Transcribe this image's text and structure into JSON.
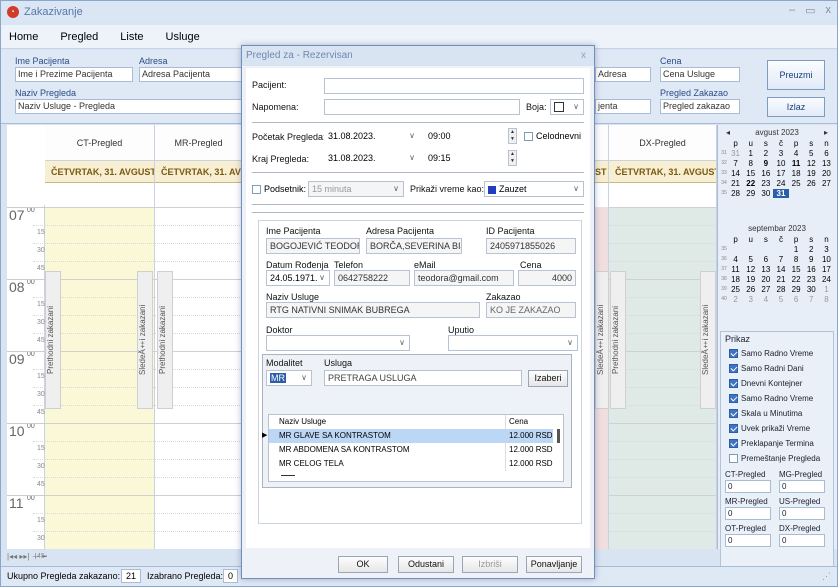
{
  "app": {
    "title": "Zakazivanje",
    "icon": "app-logo-icon"
  },
  "window_buttons": [
    "–",
    "▭",
    "x"
  ],
  "menu": [
    "Home",
    "Pregled",
    "Liste",
    "Usluge"
  ],
  "top": {
    "ime_label": "Ime Pacijenta",
    "ime_value": "Ime i Prezime Pacijenta",
    "adresa_label": "Adresa",
    "adresa_value": "Adresa Pacijenta",
    "naziv_label": "Naziv Pregleda",
    "naziv_value": "Naziv Usluge - Pregleda",
    "adresa2_value": "Adresa",
    "zak_value": "jenta",
    "cena_label": "Cena",
    "cena_value": "Cena Usluge",
    "pz_label": "Pregled Zakazao",
    "pz_value": "Pregled zakazao",
    "preuzmi": "Preuzmi",
    "izlaz": "Izlaz"
  },
  "calendar": {
    "columns": [
      {
        "name": "CT-Pregled",
        "date": "ČETVRTAK, 31. AVGUST"
      },
      {
        "name": "MR-Pregled",
        "date": "ČETVRTAK, 31. AVGUST"
      },
      {
        "name": "DX-Pregled",
        "date": "ČETVRTAK, 31. AVGUST"
      }
    ],
    "col3_date_fragment": "ST",
    "hours": [
      "07",
      "08",
      "09",
      "10",
      "11"
    ],
    "minutes": [
      "00",
      "15",
      "30",
      "45"
    ],
    "prev_label": "Prethodni zakazani",
    "next_label": "SledeÄ‡i zakazani",
    "nav": "|◂◂ ▸▸| ＋ ━"
  },
  "status": {
    "ukupno_label": "Ukupno Pregleda zakazano:",
    "ukupno_value": "21",
    "izabrano_label": "Izabrano Pregleda:",
    "izabrano_value": "0"
  },
  "minical": [
    {
      "title": "avgust 2023",
      "days": [
        "p",
        "u",
        "s",
        "č",
        "p",
        "s",
        "n"
      ],
      "weeks": [
        {
          "wk": "31",
          "d": [
            "31",
            "1",
            "2",
            "3",
            "4",
            "5",
            "6"
          ]
        },
        {
          "wk": "32",
          "d": [
            "7",
            "8",
            "9",
            "10",
            "11",
            "12",
            "13"
          ]
        },
        {
          "wk": "33",
          "d": [
            "14",
            "15",
            "16",
            "17",
            "18",
            "19",
            "20"
          ]
        },
        {
          "wk": "34",
          "d": [
            "21",
            "22",
            "23",
            "24",
            "25",
            "26",
            "27"
          ]
        },
        {
          "wk": "35",
          "d": [
            "28",
            "29",
            "30",
            "31",
            "",
            "",
            ""
          ]
        }
      ]
    },
    {
      "title": "septembar 2023",
      "days": [
        "p",
        "u",
        "s",
        "č",
        "p",
        "s",
        "n"
      ],
      "weeks": [
        {
          "wk": "35",
          "d": [
            "",
            "",
            "",
            "",
            "1",
            "2",
            "3"
          ]
        },
        {
          "wk": "36",
          "d": [
            "4",
            "5",
            "6",
            "7",
            "8",
            "9",
            "10"
          ]
        },
        {
          "wk": "37",
          "d": [
            "11",
            "12",
            "13",
            "14",
            "15",
            "16",
            "17"
          ]
        },
        {
          "wk": "38",
          "d": [
            "18",
            "19",
            "20",
            "21",
            "22",
            "23",
            "24"
          ]
        },
        {
          "wk": "39",
          "d": [
            "25",
            "26",
            "27",
            "28",
            "29",
            "30",
            "1"
          ]
        },
        {
          "wk": "40",
          "d": [
            "2",
            "3",
            "4",
            "5",
            "6",
            "7",
            "8"
          ]
        }
      ]
    }
  ],
  "prikaz": {
    "title": "Prikaz",
    "options": [
      {
        "label": "Samo Radno Vreme",
        "checked": true
      },
      {
        "label": "Samo Radni Dani",
        "checked": true
      },
      {
        "label": "Dnevni Kontejner",
        "checked": true
      },
      {
        "label": "Samo Radno Vreme",
        "checked": true
      },
      {
        "label": "Skala u Minutima",
        "checked": true
      },
      {
        "label": "Uvek prikaži Vreme",
        "checked": true
      },
      {
        "label": "Preklapanje Termina",
        "checked": true
      },
      {
        "label": "Premeštanje Pregleda",
        "checked": false
      }
    ],
    "counts": [
      {
        "label": "CT-Pregled",
        "value": "0"
      },
      {
        "label": "MG-Pregled",
        "value": "0"
      },
      {
        "label": "MR-Pregled",
        "value": "0"
      },
      {
        "label": "US-Pregled",
        "value": "0"
      },
      {
        "label": "OT-Pregled",
        "value": "0"
      },
      {
        "label": "DX-Pregled",
        "value": "0"
      }
    ]
  },
  "dialog": {
    "title": "Pregled za - Rezervisan",
    "pacijent_label": "Pacijent:",
    "napomena_label": "Napomena:",
    "boja_label": "Boja:",
    "pocetak_label": "Početak Pregleda:",
    "pocetak_date": "31.08.2023.",
    "pocetak_time": "09:00",
    "celodnevni": "Celodnevni",
    "kraj_label": "Kraj Pregleda:",
    "kraj_date": "31.08.2023.",
    "kraj_time": "09:15",
    "podsetnik": "Podsetnik:",
    "podsetnik_value": "15 minuta",
    "prikazi_label": "Prikaži vreme kao:",
    "prikazi_value": "Zauzet",
    "ime_label": "Ime Pacijenta",
    "ime": "BOGOJEVIĆ TEODORA",
    "adresa_label": "Adresa Pacijenta",
    "adresa": "BORČA,SEVERINA BIJEL",
    "id_label": "ID Pacijenta",
    "id": "2405971855026",
    "dr_label": "Datum Rođenja",
    "dr": "24.05.1971.",
    "tel_label": "Telefon",
    "tel": "0642758222",
    "email_label": "eMail",
    "email": "teodora@gmail.com",
    "cena_label": "Cena",
    "cena": "4000",
    "usluga_label": "Naziv Usluge",
    "usluga": "RTG NATIVNI SNIMAK BUBREGA",
    "zakazao_label": "Zakazao",
    "zakazao": "KO JE ZAKAZAO",
    "doktor_label": "Doktor",
    "uputio_label": "Uputio",
    "modalitet_label": "Modalitet",
    "modalitet": "MR",
    "usluga2_label": "Usluga",
    "usluga2": "PRETRAGA USLUGA",
    "izaberi": "Izaberi",
    "tbl_h1": "Naziv Usluge",
    "tbl_h2": "Cena",
    "rows": [
      {
        "naziv": "MR GLAVE SA KONTRASTOM",
        "cena": "12.000 RSD"
      },
      {
        "naziv": "MR ABDOMENA SA KONTRASTOM",
        "cena": "12.000 RSD"
      },
      {
        "naziv": "MR CELOG TELA",
        "cena": "12.000 RSD"
      }
    ],
    "ok": "OK",
    "odustani": "Odustani",
    "izbrisi": "Izbriši",
    "ponavljanje": "Ponavljanje"
  },
  "colors": {
    "accent": "#2a5ea8",
    "date_head": "#f8eed2",
    "ct_fill": "#fbf8d8",
    "dx_fill": "#dfe9e6",
    "zauzet": "#1f3fbf",
    "row_sel": "#bcd7f5"
  }
}
